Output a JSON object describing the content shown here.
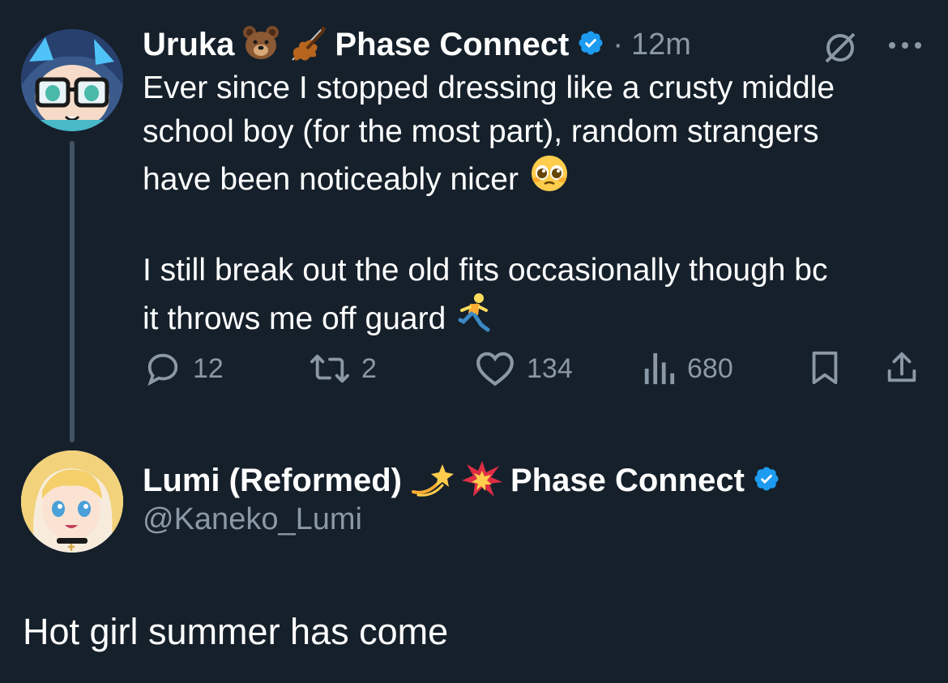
{
  "tweet": {
    "author_name": "Uruka",
    "affiliation": "Phase Connect",
    "separator": "·",
    "time": "12m",
    "text_line1": "Ever since I stopped dressing like a crusty middle",
    "text_line2": "school boy (for the most part), random strangers",
    "text_line3": "have been noticeably nicer",
    "text_line4": "I still break out the old fits occasionally though bc",
    "text_line5": "it throws me off guard",
    "replies": "12",
    "retweets": "2",
    "likes": "134",
    "views": "680"
  },
  "reply": {
    "author_name": "Lumi (Reformed)",
    "affiliation": "Phase Connect",
    "handle": "@Kaneko_Lumi",
    "text": "Hot girl summer has come"
  },
  "icons": [
    "grok-icon",
    "more-icon",
    "reply-icon",
    "retweet-icon",
    "like-icon",
    "views-icon",
    "bookmark-icon",
    "share-icon",
    "verified-icon"
  ],
  "colors": {
    "background": "#15202b",
    "text": "#ffffff",
    "muted": "#8b98a5",
    "verified": "#1d9bf0",
    "thread_line": "#425364"
  }
}
